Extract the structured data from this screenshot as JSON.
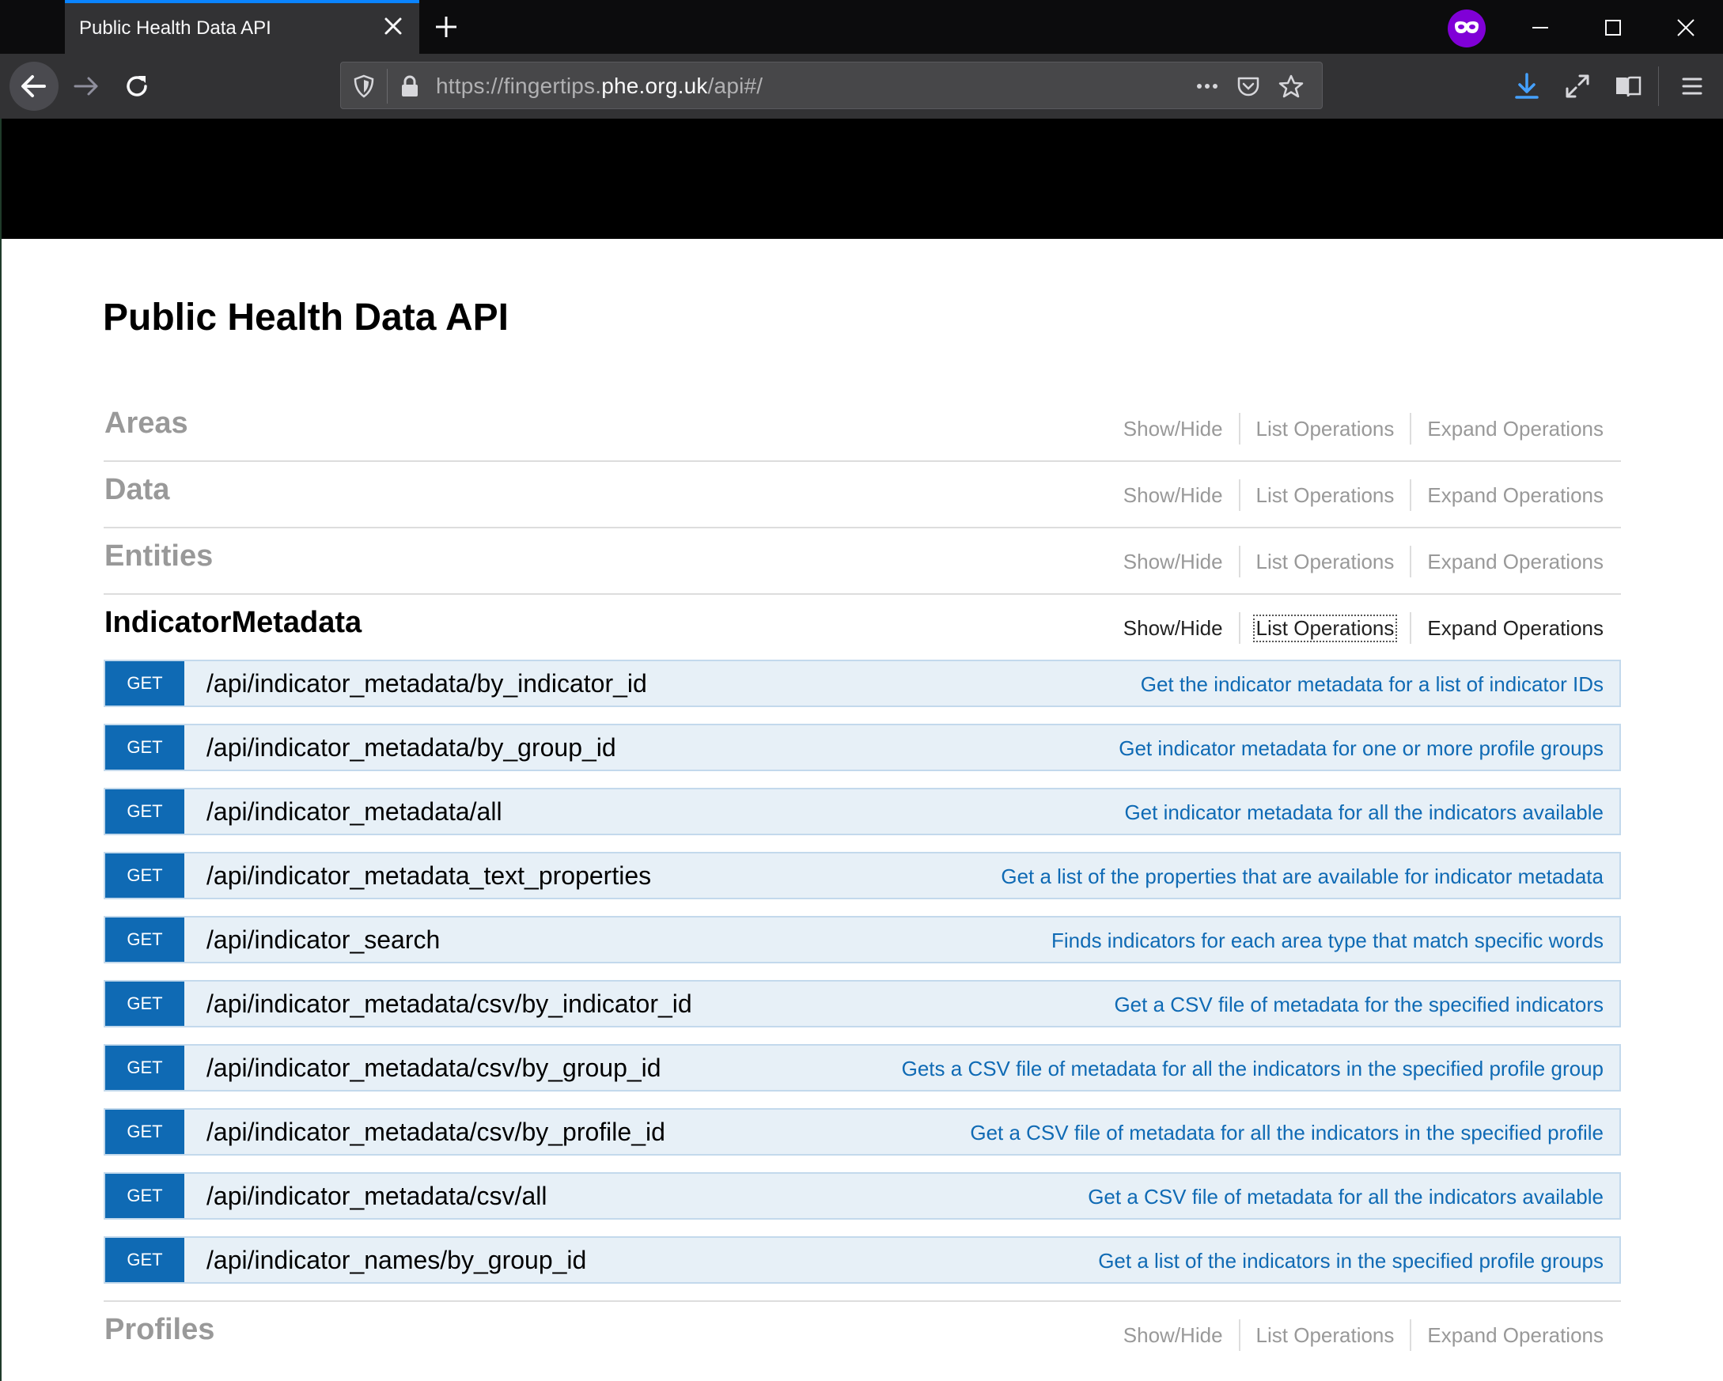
{
  "browser": {
    "tab_title": "Public Health Data API",
    "url_prefix": "https://fingertips.",
    "url_host": "phe.org.uk",
    "url_path": "/api#/",
    "accent_color": "#0a84ff",
    "private_color": "#8000d7"
  },
  "page": {
    "title": "Public Health Data API",
    "actions": {
      "show_hide": "Show/Hide",
      "list_operations": "List Operations",
      "expand_operations": "Expand Operations"
    },
    "resources": [
      {
        "name": "Areas"
      },
      {
        "name": "Data"
      },
      {
        "name": "Entities"
      },
      {
        "name": "IndicatorMetadata"
      },
      {
        "name": "Profiles"
      }
    ],
    "operations": [
      {
        "method": "GET",
        "path": "/api/indicator_metadata/by_indicator_id",
        "summary": "Get the indicator metadata for a list of indicator IDs"
      },
      {
        "method": "GET",
        "path": "/api/indicator_metadata/by_group_id",
        "summary": "Get indicator metadata for one or more profile groups"
      },
      {
        "method": "GET",
        "path": "/api/indicator_metadata/all",
        "summary": "Get indicator metadata for all the indicators available"
      },
      {
        "method": "GET",
        "path": "/api/indicator_metadata_text_properties",
        "summary": "Get a list of the properties that are available for indicator metadata"
      },
      {
        "method": "GET",
        "path": "/api/indicator_search",
        "summary": "Finds indicators for each area type that match specific words"
      },
      {
        "method": "GET",
        "path": "/api/indicator_metadata/csv/by_indicator_id",
        "summary": "Get a CSV file of metadata for the specified indicators"
      },
      {
        "method": "GET",
        "path": "/api/indicator_metadata/csv/by_group_id",
        "summary": "Gets a CSV file of metadata for all the indicators in the specified profile group"
      },
      {
        "method": "GET",
        "path": "/api/indicator_metadata/csv/by_profile_id",
        "summary": "Get a CSV file of metadata for all the indicators in the specified profile"
      },
      {
        "method": "GET",
        "path": "/api/indicator_metadata/csv/all",
        "summary": "Get a CSV file of metadata for all the indicators available"
      },
      {
        "method": "GET",
        "path": "/api/indicator_names/by_group_id",
        "summary": "Get a list of the indicators in the specified profile groups"
      }
    ],
    "colors": {
      "get_method": "#0f6ab4",
      "op_background": "#e7f0f7",
      "inactive_resource": "#999999"
    }
  },
  "icons": {
    "tab_close": "close-icon",
    "new_tab": "plus-icon",
    "private": "private-browsing-mask-icon",
    "back": "back-arrow-icon",
    "forward": "forward-arrow-icon",
    "reload": "reload-icon",
    "tracking": "shield-icon",
    "lock": "lock-icon",
    "page_actions": "more-icon",
    "pocket": "pocket-icon",
    "bookmark": "star-icon",
    "downloads": "download-icon",
    "fullscreen": "expand-icon",
    "reader": "reader-view-icon",
    "menu": "hamburger-menu-icon"
  }
}
